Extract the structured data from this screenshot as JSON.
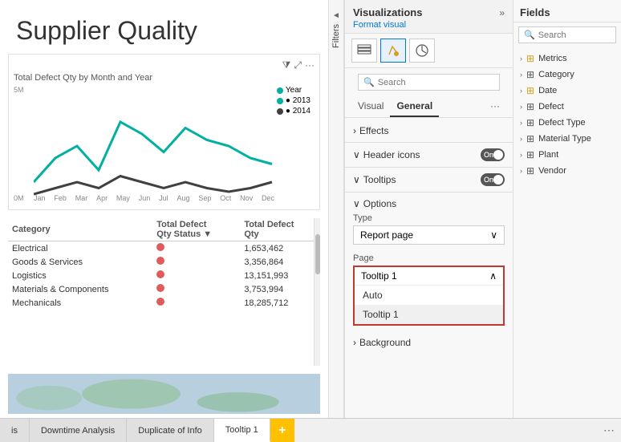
{
  "report": {
    "title": "Supplier Quality",
    "chart": {
      "title": "Total Defect Qty by Month and Year",
      "yLabels": [
        "5M",
        "0M"
      ],
      "xLabels": [
        "Jan",
        "Feb",
        "Mar",
        "Apr",
        "May",
        "Jun",
        "Jul",
        "Aug",
        "Sep",
        "Oct",
        "Nov",
        "Dec"
      ],
      "legend": [
        {
          "label": "2013",
          "color": "#00b0a0"
        },
        {
          "label": "2014",
          "color": "#404040"
        }
      ]
    },
    "table": {
      "headers": [
        "Category",
        "Total Defect\nQty Status",
        "Total Defect\nQty"
      ],
      "rows": [
        {
          "category": "Electrical",
          "qty": "1,653,462"
        },
        {
          "category": "Goods & Services",
          "qty": "3,356,864"
        },
        {
          "category": "Logistics",
          "qty": "13,151,993"
        },
        {
          "category": "Materials & Components",
          "qty": "3,753,994"
        },
        {
          "category": "Mechanicals",
          "qty": "18,285,712"
        }
      ]
    }
  },
  "visualizations": {
    "title": "Visualizations",
    "subtitle": "Format visual",
    "expand_icon": "»",
    "search_placeholder": "Search",
    "tabs": [
      {
        "label": "Visual",
        "active": false
      },
      {
        "label": "General",
        "active": true
      },
      {
        "label": "...",
        "active": false
      }
    ],
    "sections": [
      {
        "label": "Effects",
        "chevron": "›",
        "expanded": false
      },
      {
        "label": "Header icons",
        "chevron": "",
        "toggle": true,
        "toggle_state": "On"
      },
      {
        "label": "Tooltips",
        "chevron": "∨",
        "toggle": true,
        "toggle_state": "On"
      },
      {
        "label": "Options",
        "chevron": "∨",
        "expanded": true
      }
    ],
    "options": {
      "type_label": "Type",
      "type_value": "Report page",
      "page_label": "Page",
      "page_value": "Tooltip 1",
      "page_options": [
        "Auto",
        "Tooltip 1"
      ]
    },
    "background": {
      "label": "Background",
      "chevron": "›"
    }
  },
  "fields": {
    "title": "Fields",
    "search_placeholder": "Search",
    "items": [
      {
        "label": "Metrics",
        "icon": "table",
        "has_chevron": true,
        "yellow": true
      },
      {
        "label": "Category",
        "icon": "table",
        "has_chevron": true
      },
      {
        "label": "Date",
        "icon": "table",
        "has_chevron": true,
        "yellow": true
      },
      {
        "label": "Defect",
        "icon": "table",
        "has_chevron": true
      },
      {
        "label": "Defect Type",
        "icon": "table",
        "has_chevron": true
      },
      {
        "label": "Material Type",
        "icon": "table",
        "has_chevron": true
      },
      {
        "label": "Plant",
        "icon": "table",
        "has_chevron": true
      },
      {
        "label": "Vendor",
        "icon": "table",
        "has_chevron": true
      }
    ]
  },
  "bottom_tabs": [
    {
      "label": "is",
      "active": false
    },
    {
      "label": "Downtime Analysis",
      "active": false
    },
    {
      "label": "Duplicate of Info",
      "active": false
    },
    {
      "label": "Tooltip 1",
      "active": true
    }
  ],
  "add_tab_label": "+"
}
